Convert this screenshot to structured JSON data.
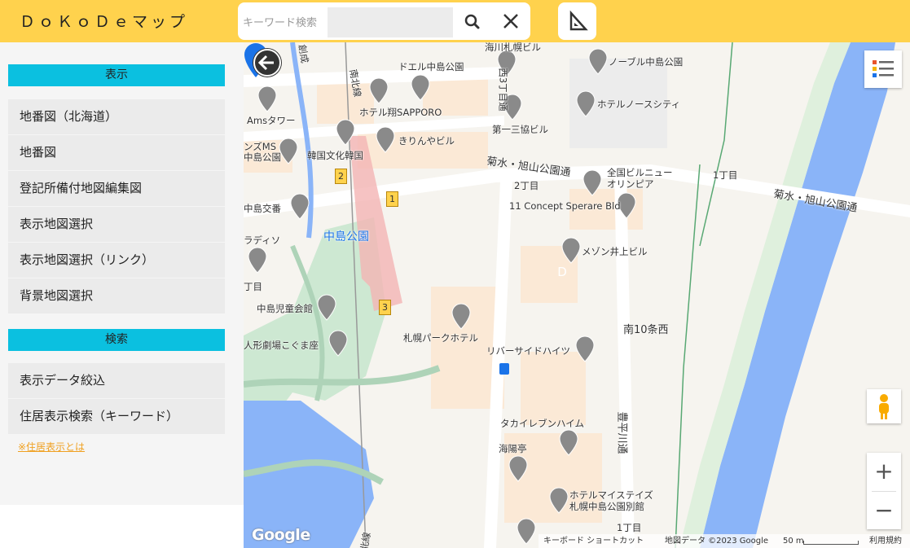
{
  "header": {
    "title": "ＤｏＫｏＤｅマップ",
    "search_label": "キーワード検索",
    "search_value": ""
  },
  "sidebar": {
    "display_header": "表示",
    "display_items": [
      "地番図（北海道）",
      "地番図",
      "登記所備付地図編集図",
      "表示地図選択",
      "表示地図選択（リンク）",
      "背景地図選択"
    ],
    "search_header": "検索",
    "search_items": [
      "表示データ絞込",
      "住居表示検索（キーワード）"
    ],
    "info_link": "※住居表示とは"
  },
  "map": {
    "labels": {
      "road_main1": "菊水・旭山公園通",
      "road_main2": "菊水・旭山公園通",
      "road_vertical": "南北線",
      "road_toyohira": "豊平川通",
      "road_south10": "南10条西",
      "station": "中島公園",
      "chome_2": "2丁目",
      "chome_1a": "1丁目",
      "chome_1b": "1丁目",
      "chome_left": "丁目",
      "p1": "海川札幌ビル",
      "p2": "ドエル中島公園",
      "p3": "ノーブル中島公園",
      "p4": "西3丁目通",
      "p5": "ホテル翔SAPPORO",
      "p6": "ホテルノースシティ",
      "p7": "Amsタワー",
      "p8": "第一三協ビル",
      "p9": "ンズMS",
      "p10": "中島公園",
      "p11": "きりんやビル",
      "p12": "韓国文化韓国",
      "p13": "全国ビルニュー",
      "p14": "オリンピア",
      "p15": "中島交番",
      "p16": "11 Concept Sperare Bld",
      "p17": "ラディソ",
      "p18": "メゾン井上ビル",
      "p19": "中島児童会館",
      "p20": "人形劇場こぐま座",
      "p21": "札幌パークホテル",
      "p22": "リバーサイドハイツ",
      "p23": "タカイレブンハイム",
      "p24": "海陽亭",
      "p25": "ホテルマイステイズ",
      "p26": "札幌中島公園別館",
      "p27": "創成",
      "p28": "北線"
    },
    "pin_letter": "D",
    "track_numbers": [
      "2",
      "1",
      "3"
    ],
    "attribution": {
      "shortcuts": "キーボード ショートカット",
      "map_data": "地図データ ©2023 Google",
      "scale": "50 m",
      "terms": "利用規約"
    },
    "google_logo": "Google",
    "zoom_in": "+",
    "zoom_out": "−"
  }
}
